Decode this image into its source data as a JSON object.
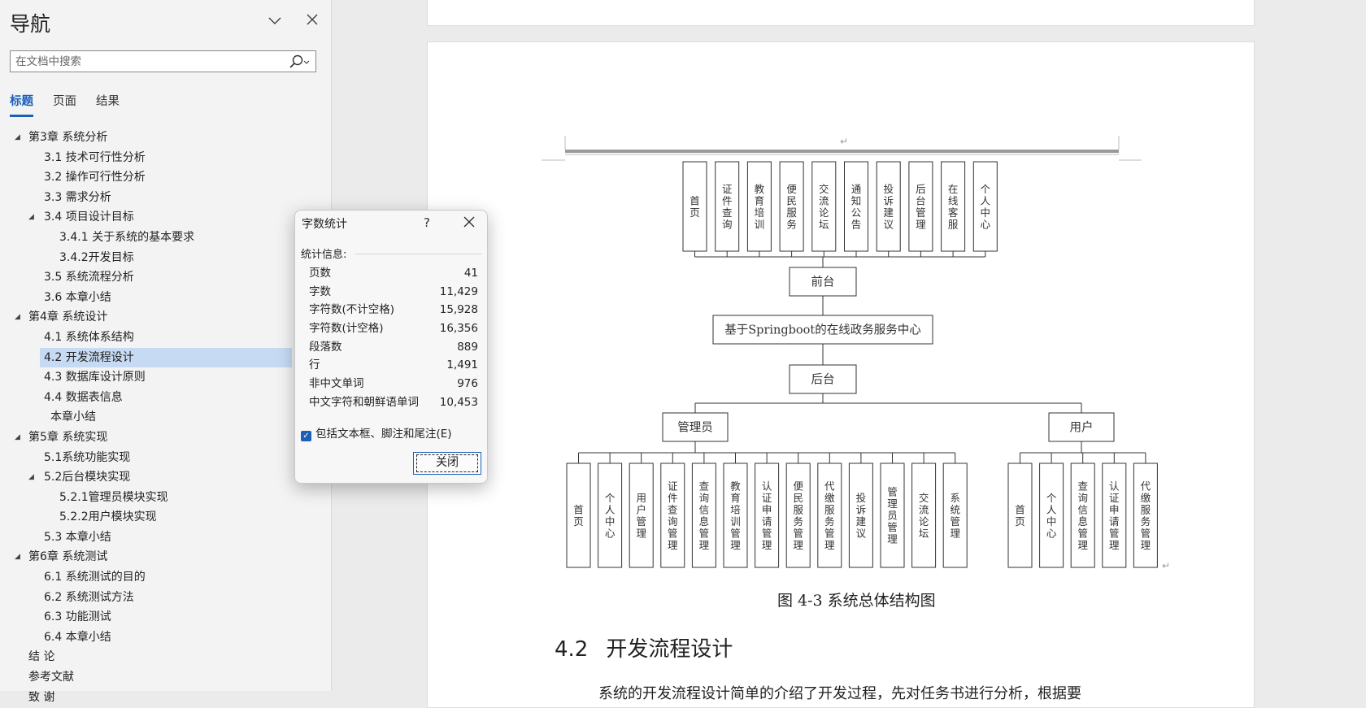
{
  "nav": {
    "title": "导航",
    "search_placeholder": "在文档中搜索",
    "tabs": [
      {
        "label": "标题",
        "active": true
      },
      {
        "label": "页面",
        "active": false
      },
      {
        "label": "结果",
        "active": false
      }
    ],
    "tree": [
      {
        "label": "第3章 系统分析",
        "level": 0,
        "expanded": true
      },
      {
        "label": "3.1 技术可行性分析",
        "level": 1
      },
      {
        "label": "3.2  操作可行性分析",
        "level": 1
      },
      {
        "label": "3.3 需求分析",
        "level": 1
      },
      {
        "label": "3.4 项目设计目标",
        "level": 1,
        "expanded": true
      },
      {
        "label": "3.4.1 关于系统的基本要求",
        "level": 2
      },
      {
        "label": "3.4.2开发目标",
        "level": 2
      },
      {
        "label": "3.5 系统流程分析",
        "level": 1
      },
      {
        "label": "3.6 本章小结",
        "level": 1
      },
      {
        "label": "第4章  系统设计",
        "level": 0,
        "expanded": true
      },
      {
        "label": "4.1 系统体系结构",
        "level": 1
      },
      {
        "label": "4.2  开发流程设计",
        "level": 1,
        "selected": true
      },
      {
        "label": "4.3  数据库设计原则",
        "level": 1
      },
      {
        "label": "4.4  数据表信息",
        "level": 1
      },
      {
        "label": "本章小结",
        "level": 1.5
      },
      {
        "label": "第5章  系统实现",
        "level": 0,
        "expanded": true
      },
      {
        "label": "5.1系统功能实现",
        "level": 1
      },
      {
        "label": "5.2后台模块实现",
        "level": 1,
        "expanded": true
      },
      {
        "label": "5.2.1管理员模块实现",
        "level": 2
      },
      {
        "label": "5.2.2用户模块实现",
        "level": 2
      },
      {
        "label": "5.3  本章小结",
        "level": 1
      },
      {
        "label": "第6章  系统测试",
        "level": 0,
        "expanded": true
      },
      {
        "label": "6.1  系统测试的目的",
        "level": 1
      },
      {
        "label": "6.2  系统测试方法",
        "level": 1
      },
      {
        "label": "6.3  功能测试",
        "level": 1
      },
      {
        "label": "6.4  本章小结",
        "level": 1
      },
      {
        "label": "结 论",
        "level": 0
      },
      {
        "label": "参考文献",
        "level": 0
      },
      {
        "label": "致  谢",
        "level": 0
      }
    ]
  },
  "dialog": {
    "title": "字数统计",
    "help": "?",
    "section_label": "统计信息:",
    "stats": [
      {
        "label": "页数",
        "value": "41"
      },
      {
        "label": "字数",
        "value": "11,429"
      },
      {
        "label": "字符数(不计空格)",
        "value": "15,928"
      },
      {
        "label": "字符数(计空格)",
        "value": "16,356"
      },
      {
        "label": "段落数",
        "value": "889"
      },
      {
        "label": "行",
        "value": "1,491"
      },
      {
        "label": "非中文单词",
        "value": "976"
      },
      {
        "label": "中文字符和朝鲜语单词",
        "value": "10,453"
      }
    ],
    "checkbox_label": "包括文本框、脚注和尾注(E)",
    "checkbox_checked": true,
    "close_button": "关闭"
  },
  "document": {
    "diagram": {
      "front_modules": [
        "首页",
        "证件查询",
        "教育培训",
        "便民服务",
        "交流论坛",
        "通知公告",
        "投诉建议",
        "后台管理",
        "在线客服",
        "个人中心"
      ],
      "front_label": "前台",
      "system_label": "基于Springboot的在线政务服务中心",
      "back_label": "后台",
      "admin_label": "管理员",
      "user_label": "用户",
      "admin_modules": [
        "首页",
        "个人中心",
        "用户管理",
        "证件查询管理",
        "查询信息管理",
        "教育培训管理",
        "认证申请管理",
        "便民服务管理",
        "代缴服务管理",
        "投诉建议",
        "管理员管理",
        "交流论坛",
        "系统管理"
      ],
      "user_modules": [
        "首页",
        "个人中心",
        "查询信息管理",
        "认证申请管理",
        "代缴服务管理"
      ]
    },
    "figure_caption": "图 4-3  系统总体结构图",
    "section_number": "4.2",
    "section_title": "开发流程设计",
    "body_text": "系统的开发流程设计简单的介绍了开发过程，先对任务书进行分析，根据要"
  }
}
